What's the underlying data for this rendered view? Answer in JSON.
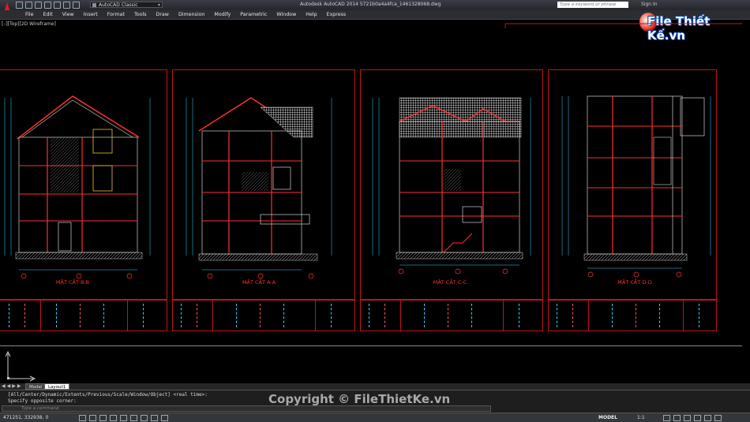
{
  "titlebar": {
    "workspace": "AutoCAD Classic",
    "app_title": "Autodesk AutoCAD 2014    5721b0a4a4fca_1461328068.dwg",
    "search_placeholder": "Type a keyword or phrase",
    "sign_in": "Sign In"
  },
  "menu": [
    "File",
    "Edit",
    "View",
    "Insert",
    "Format",
    "Tools",
    "Draw",
    "Dimension",
    "Modify",
    "Parametric",
    "Window",
    "Help",
    "Express"
  ],
  "viewport": {
    "label": "[–][Top][2D Wireframe]"
  },
  "sheets": [
    {
      "label": "MẶT CẮT B-B"
    },
    {
      "label": "MẶT CẮT A-A"
    },
    {
      "label": "MẶT CẮT C-C"
    },
    {
      "label": "MẶT CẮT D-D"
    }
  ],
  "tabs": {
    "nav": "◀◀▶▶",
    "model": "Model",
    "layout1": "Layout1"
  },
  "command": {
    "history_1": "[All/Center/Dynamic/Extents/Previous/Scale/Window/Object] <real time>:",
    "history_2": "Specify opposite corner:",
    "placeholder": "Type a command"
  },
  "status": {
    "coords": "471251, 332938, 0",
    "mode": "MODEL",
    "scale": "1:1"
  },
  "watermark": "Copyright © FileThietKe.vn",
  "brand": "File Thiết Kế.vn",
  "colors": {
    "frame": "#c0141a",
    "dimension": "#2ad8ff",
    "wall": "#ff3030",
    "background": "#000000"
  }
}
